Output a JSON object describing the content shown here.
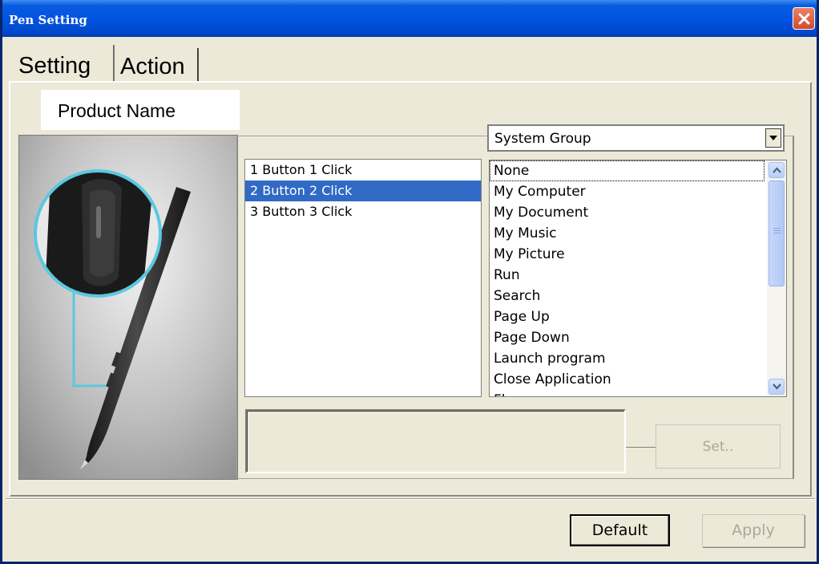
{
  "window": {
    "title": "Pen Setting",
    "close_icon": "close-icon"
  },
  "tabs": [
    {
      "label": "Setting",
      "active": true
    },
    {
      "label": "Action",
      "active": false
    }
  ],
  "product_name": "Product Name",
  "button_list": [
    {
      "label": "1  Button 1 Click",
      "selected": false
    },
    {
      "label": "2  Button 2 Click",
      "selected": true
    },
    {
      "label": "3  Button 3 Click",
      "selected": false
    }
  ],
  "group_select": {
    "value": "System Group"
  },
  "action_list": [
    "None",
    "My Computer",
    "My Document",
    "My Music",
    "My Picture",
    "Run",
    "Search",
    "Page Up",
    "Page Down",
    "Launch program",
    "Close Application",
    "Fl..."
  ],
  "buttons": {
    "set": "Set..",
    "default": "Default",
    "apply": "Apply"
  },
  "colors": {
    "title_bar": "#0054e3",
    "selection": "#316ac5",
    "dialog_bg": "#ece9d8",
    "pen_highlight": "#5ac8e0"
  }
}
